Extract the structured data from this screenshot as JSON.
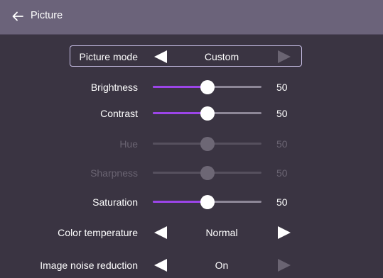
{
  "header": {
    "title": "Picture",
    "back_icon": "arrow-left-icon"
  },
  "colors": {
    "header_bg": "#6b637a",
    "panel_bg": "#3a3442",
    "accent": "#9b45e8",
    "focus_border": "#c8bfe6"
  },
  "settings": {
    "picture_mode": {
      "label": "Picture mode",
      "value": "Custom",
      "left_arrow_enabled": true,
      "right_arrow_enabled": false
    },
    "brightness": {
      "label": "Brightness",
      "value": "50",
      "level": 0.5,
      "enabled": true
    },
    "contrast": {
      "label": "Contrast",
      "value": "50",
      "level": 0.5,
      "enabled": true
    },
    "hue": {
      "label": "Hue",
      "value": "50",
      "level": 0.5,
      "enabled": false
    },
    "sharpness": {
      "label": "Sharpness",
      "value": "50",
      "level": 0.5,
      "enabled": false
    },
    "saturation": {
      "label": "Saturation",
      "value": "50",
      "level": 0.5,
      "enabled": true
    },
    "color_temperature": {
      "label": "Color temperature",
      "value": "Normal",
      "left_arrow_enabled": true,
      "right_arrow_enabled": true
    },
    "noise_reduction": {
      "label": "Image noise reduction",
      "value": "On",
      "left_arrow_enabled": true,
      "right_arrow_enabled": false
    }
  }
}
